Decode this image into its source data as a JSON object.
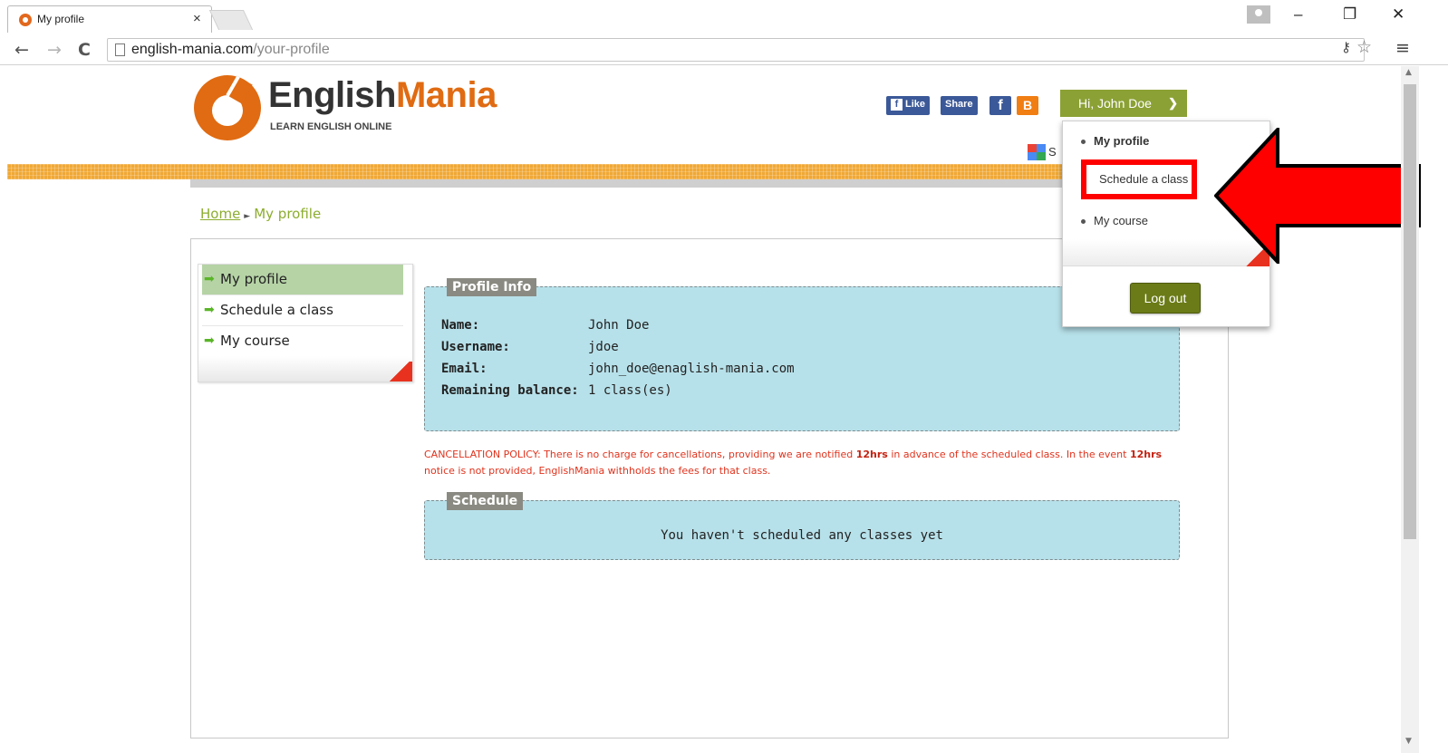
{
  "browser": {
    "tab_title": "My profile",
    "tab_close": "×",
    "url_host": "english-mania.com",
    "url_path": "/your-profile",
    "minimize": "–",
    "restore": "❐",
    "close": "✕"
  },
  "site": {
    "logo_english": "English",
    "logo_mania": "Mania",
    "tagline": "LEARN ENGLISH ONLINE",
    "accent_orange": "#e06b12",
    "accent_green": "#8ba135"
  },
  "social": {
    "like": "Like",
    "share": "Share",
    "fb": "f",
    "b": "B"
  },
  "user_menu": {
    "greeting": "Hi, John Doe",
    "items": [
      "My profile",
      "Schedule a class",
      "My course"
    ],
    "logout": "Log out"
  },
  "translate_initial": "S",
  "breadcrumb": {
    "home": "Home",
    "current": "My profile"
  },
  "sidebar": {
    "items": [
      "My profile",
      "Schedule a class",
      "My course"
    ],
    "active_index": 0
  },
  "profile_info": {
    "title": "Profile Info",
    "fields": [
      {
        "label": "Name:",
        "value": "John Doe"
      },
      {
        "label": "Username:",
        "value": "jdoe"
      },
      {
        "label": "Email:",
        "value": "john_doe@enaglish-mania.com"
      },
      {
        "label": "Remaining balance:",
        "value": "1 class(es)"
      }
    ]
  },
  "policy": {
    "part1": "CANCELLATION POLICY: There is no charge for cancellations, providing we are notified ",
    "bold1": "12hrs",
    "part2": " in advance of the scheduled class. In the event ",
    "bold2": "12hrs",
    "part3": " notice is not provided, EnglishMania withholds the fees for that class."
  },
  "schedule": {
    "title": "Schedule",
    "empty": "You haven't scheduled any classes yet"
  },
  "annotation": {
    "highlight_color": "#ff0000"
  }
}
